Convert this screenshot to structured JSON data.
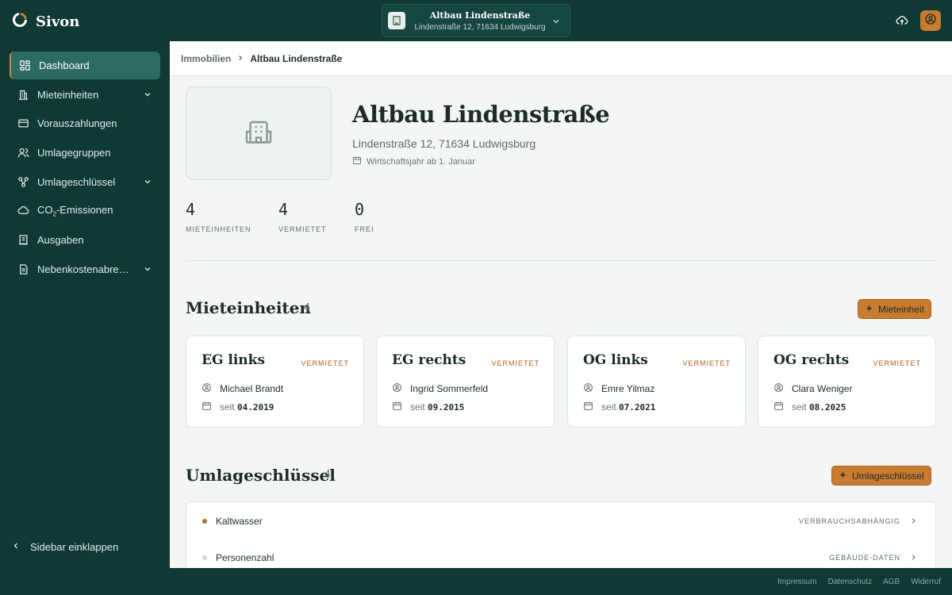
{
  "app": {
    "name": "Sivon",
    "logo_icon": "sivon-logo-icon"
  },
  "header": {
    "property_name": "Altbau Lindenstraße",
    "property_address": "Lindenstraße 12, 71634 Ludwigsburg",
    "upload_icon": "cloud-upload-icon",
    "user_icon": "user-circle-icon"
  },
  "sidebar": {
    "items": [
      {
        "label": "Dashboard",
        "icon": "dashboard-icon",
        "active": true
      },
      {
        "label": "Mieteinheiten",
        "icon": "building-icon",
        "expandable": true
      },
      {
        "label": "Vorauszahlungen",
        "icon": "credit-card-icon"
      },
      {
        "label": "Umlagegruppen",
        "icon": "users-icon"
      },
      {
        "label": "Umlageschlüssel",
        "icon": "share-nodes-icon",
        "expandable": true
      },
      {
        "label_pre": "CO",
        "label_sub": "2",
        "label_post": "-Emissionen",
        "icon": "cloud-icon"
      },
      {
        "label": "Ausgaben",
        "icon": "receipt-icon"
      },
      {
        "label": "Nebenkostenabrechnungen",
        "icon": "document-icon",
        "expandable": true
      }
    ],
    "collapse_label": "Sidebar einklappen"
  },
  "breadcrumb": {
    "parent": "Immobilien",
    "current": "Altbau Lindenstraße"
  },
  "property": {
    "title": "Altbau Lindenstraße",
    "address": "Lindenstraße 12, 71634 Ludwigsburg",
    "fiscal_year": "Wirtschaftsjahr ab 1. Januar"
  },
  "stats": [
    {
      "value": "4",
      "label": "MIETEINHEITEN"
    },
    {
      "value": "4",
      "label": "VERMIETET"
    },
    {
      "value": "0",
      "label": "FREI"
    }
  ],
  "units_section": {
    "title": "Mieteinheiten",
    "count": "4",
    "add_label": "Mieteinheit",
    "units": [
      {
        "name": "EG links",
        "status": "VERMIETET",
        "tenant": "Michael Brandt",
        "since_prefix": "seit",
        "since": "04.2019"
      },
      {
        "name": "EG rechts",
        "status": "VERMIETET",
        "tenant": "Ingrid Sommerfeld",
        "since_prefix": "seit",
        "since": "09.2015"
      },
      {
        "name": "OG links",
        "status": "VERMIETET",
        "tenant": "Emre Yilmaz",
        "since_prefix": "seit",
        "since": "07.2021"
      },
      {
        "name": "OG rechts",
        "status": "VERMIETET",
        "tenant": "Clara Weniger",
        "since_prefix": "seit",
        "since": "08.2025"
      }
    ]
  },
  "keys_section": {
    "title": "Umlageschlüssel",
    "count": "4",
    "add_label": "Umlageschlüssel",
    "keys": [
      {
        "name": "Kaltwasser",
        "type": "VERBRAUCHSABHÄNGIG",
        "dot_color": "#b86f2a"
      },
      {
        "name": "Personenzahl",
        "type": "GEBÄUDE-DATEN",
        "dot_color": "#cfd6d4"
      }
    ]
  },
  "footer": {
    "links": [
      "Impressum",
      "Datenschutz",
      "AGB",
      "Widerruf"
    ]
  },
  "colors": {
    "brand_dark": "#0e3934",
    "accent": "#c97c30",
    "active_nav": "#2d6a60"
  }
}
